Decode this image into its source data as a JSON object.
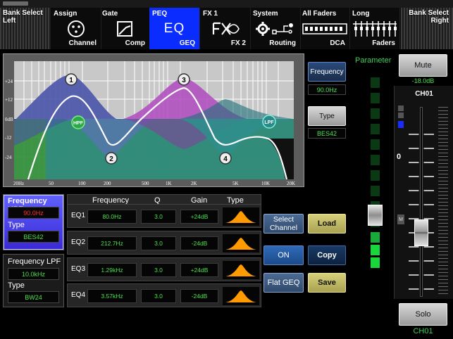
{
  "nav": {
    "bank_left": "Bank Select\nLeft",
    "bank_right": "Bank Select\nRight",
    "tabs": [
      {
        "top": "Assign",
        "bottom": "Channel",
        "icon": "xlr-connector-icon"
      },
      {
        "top": "Gate",
        "bottom": "Comp",
        "icon": "compressor-curve-icon"
      },
      {
        "top": "PEQ",
        "bottom": "GEQ",
        "icon": "eq-icon",
        "label": "EQ"
      },
      {
        "top": "FX 1",
        "bottom": "FX 2",
        "icon": "fx-icon"
      },
      {
        "top": "System",
        "bottom": "Routing",
        "icon": "gear-routing-icon"
      },
      {
        "top": "All Faders",
        "bottom": "DCA",
        "icon": "faders-row-icon"
      },
      {
        "top": "Long",
        "bottom": "Faders",
        "icon": "long-faders-icon"
      }
    ]
  },
  "graph": {
    "y_ticks": [
      "+24",
      "+12",
      "0dB",
      "-12",
      "-24"
    ],
    "x_ticks": [
      "20Hz",
      "50",
      "100",
      "200",
      "500",
      "1K",
      "2K",
      "5K",
      "10K",
      "20K"
    ],
    "node_labels": [
      "1",
      "2",
      "3",
      "4"
    ],
    "hpf_label": "HPF",
    "lpf_label": "LPF"
  },
  "param": {
    "frequency_label": "Frequency",
    "frequency_value": "90.0Hz",
    "type_label": "Type",
    "type_value": "BES42",
    "parameter_label": "Parameter"
  },
  "hpf": {
    "title": "Frequency HPF",
    "freq": "90.0Hz",
    "type_label": "Type",
    "type": "BES42"
  },
  "lpf": {
    "title": "Frequency LPF",
    "freq": "10.0kHz",
    "type_label": "Type",
    "type": "BW24"
  },
  "eq": {
    "headers": [
      "Frequency",
      "Q",
      "Gain",
      "Type"
    ],
    "bands": [
      {
        "name": "EQ1",
        "freq": "80.0Hz",
        "q": "3.0",
        "gain": "+24dB"
      },
      {
        "name": "EQ2",
        "freq": "212.7Hz",
        "q": "3.0",
        "gain": "-24dB"
      },
      {
        "name": "EQ3",
        "freq": "1.29kHz",
        "q": "3.0",
        "gain": "+24dB"
      },
      {
        "name": "EQ4",
        "freq": "3.57kHz",
        "q": "3.0",
        "gain": "-24dB"
      }
    ]
  },
  "actions": {
    "select_channel": "Select Channel",
    "load": "Load",
    "on": "ON",
    "copy": "Copy",
    "flat_geq": "Flat GEQ",
    "save": "Save"
  },
  "channel": {
    "mute": "Mute",
    "level": "-18.0dB",
    "name": "CH01",
    "zero": "0",
    "m_label": "M",
    "solo": "Solo",
    "footer": "CH01"
  },
  "colors": {
    "accent_blue": "#0a2cff",
    "value_green": "#4be34b",
    "hpf_red": "#ff3030",
    "orange_shape": "#ff9a00"
  }
}
